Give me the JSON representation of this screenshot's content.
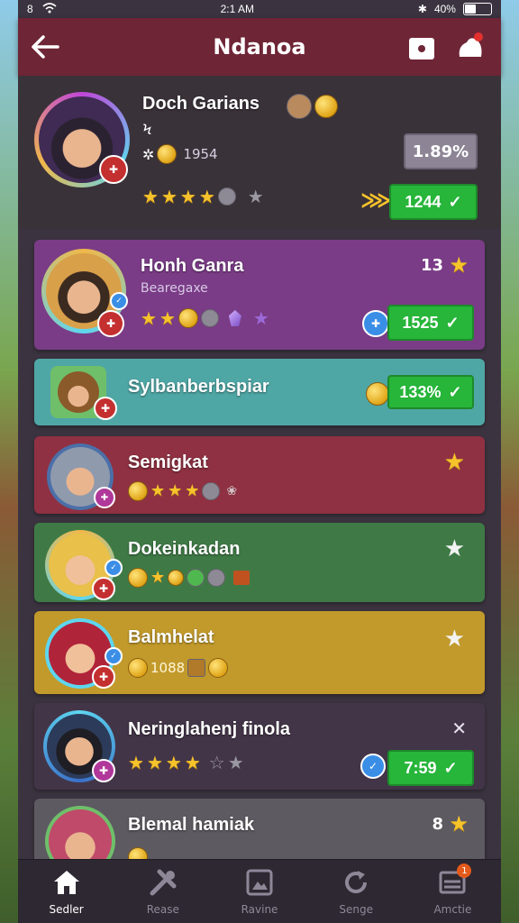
{
  "status": {
    "time": "2:1 AM",
    "battery": "40%",
    "battery_fraction": 0.4
  },
  "header": {
    "title": "Ndanoa",
    "back_icon": "back-arrow-icon",
    "shop_icon": "shop-bag-icon",
    "notif_icon": "notification-icon"
  },
  "profile": {
    "name": "Doch Garians",
    "subtitle": "Ϟ",
    "coins": "1954",
    "percent": "1.89%",
    "score": "1244",
    "stars": 4
  },
  "cards": [
    {
      "name": "Honh Ganra",
      "sub": "Bearegaxe",
      "rank": "13",
      "score": "1525",
      "stars": 2
    },
    {
      "name": "Sylbanberbspiar",
      "percent": "133%"
    },
    {
      "name": "Semigkat",
      "stars": 3
    },
    {
      "name": "Dokeinkadan",
      "stars": 1
    },
    {
      "name": "Balmhelat",
      "stat": "1088"
    },
    {
      "name": "Neringlahenj finola",
      "score": "7:59",
      "stars": 4
    },
    {
      "name": "Blemal hamiak",
      "rank": "8"
    }
  ],
  "nav": [
    {
      "label": "Sedler",
      "icon": "home-icon",
      "active": true
    },
    {
      "label": "Rease",
      "icon": "tools-icon",
      "active": false
    },
    {
      "label": "Ravine",
      "icon": "image-frame-icon",
      "active": false
    },
    {
      "label": "Senge",
      "icon": "refresh-icon",
      "active": false
    },
    {
      "label": "Amctie",
      "icon": "inbox-icon",
      "active": false,
      "badge": "1"
    }
  ]
}
